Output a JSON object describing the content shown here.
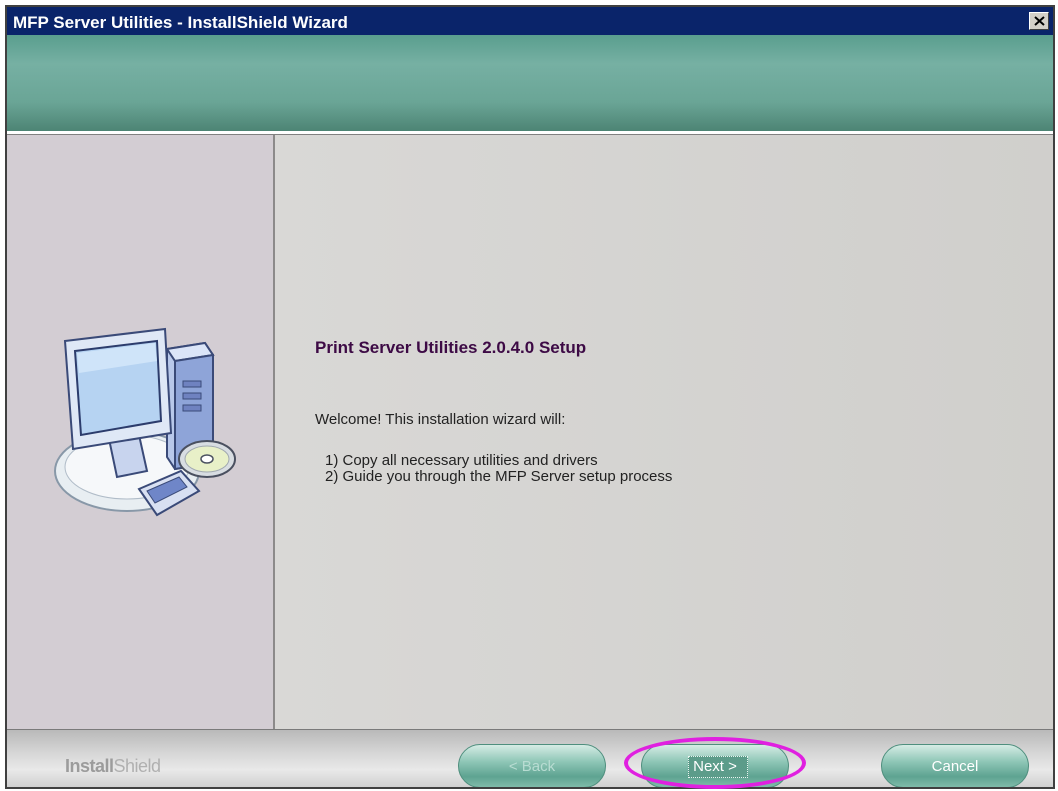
{
  "window": {
    "title": "MFP Server Utilities - InstallShield Wizard"
  },
  "content": {
    "setup_title": "Print Server Utilities 2.0.4.0 Setup",
    "welcome": "Welcome! This installation wizard will:",
    "steps": [
      "1) Copy all necessary utilities and drivers",
      "2) Guide you through the MFP Server setup process"
    ]
  },
  "footer": {
    "brand_bold": "Install",
    "brand_thin": "Shield",
    "back_label": "< Back",
    "next_label": "Next >",
    "cancel_label": "Cancel"
  },
  "icons": {
    "close": "close-icon",
    "computer": "computer-setup-illustration"
  },
  "colors": {
    "titlebar": "#0a246a",
    "banner": "#6aa596",
    "highlight": "#e020e0",
    "setup_title": "#3d0a45"
  }
}
